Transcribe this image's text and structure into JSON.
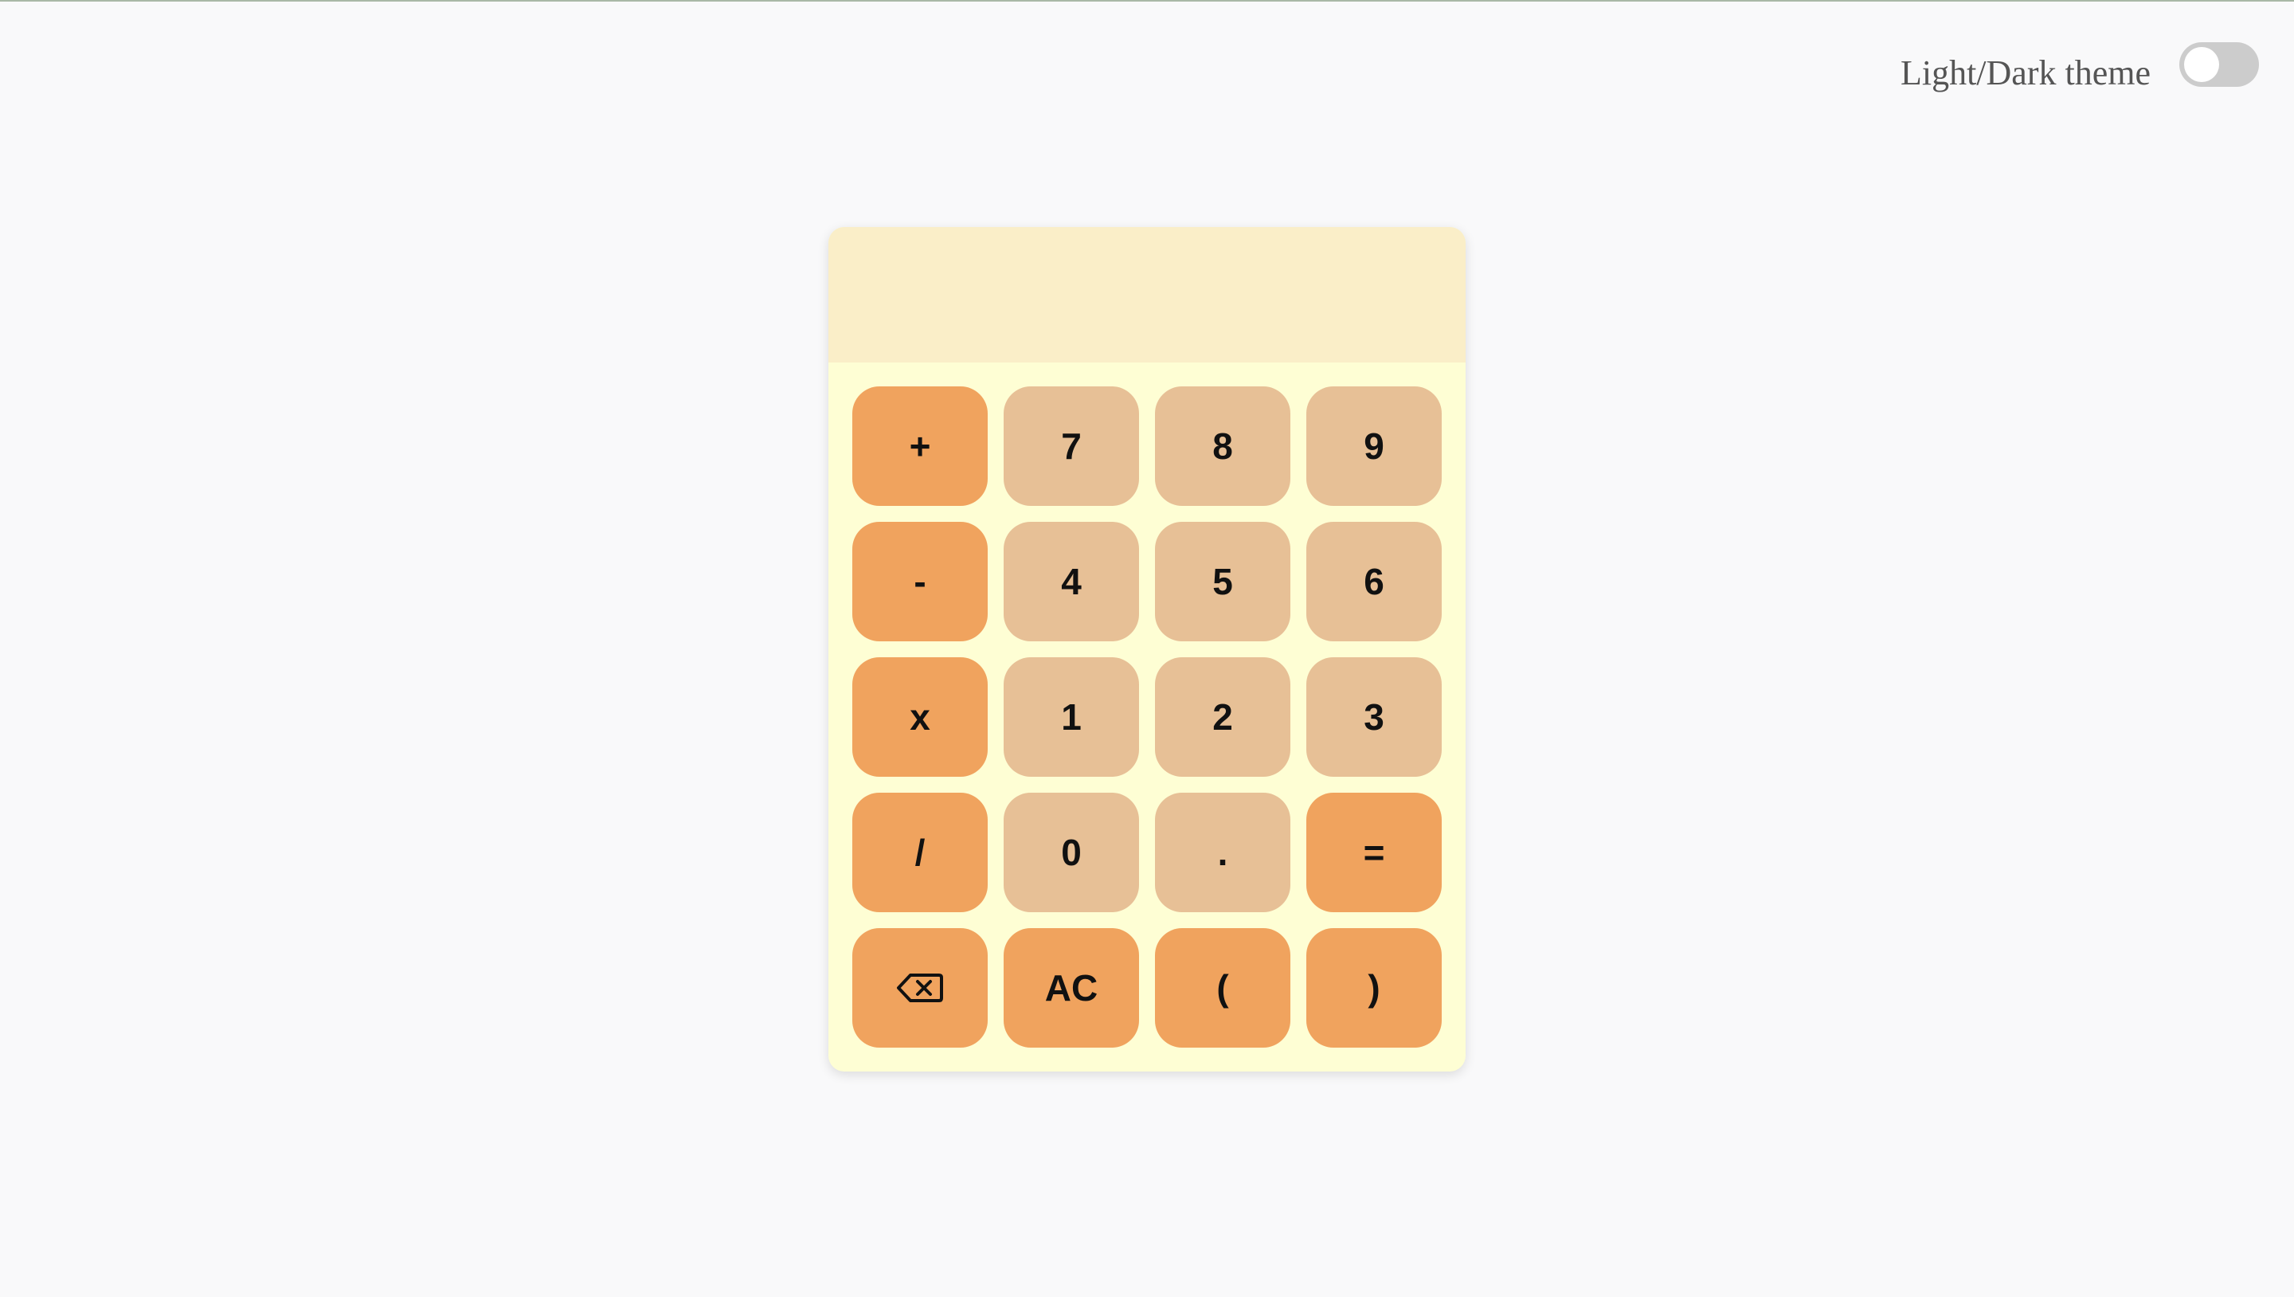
{
  "header": {
    "theme_label": "Light/Dark theme",
    "theme_toggle_on": false
  },
  "calculator": {
    "display_value": "",
    "keys": [
      {
        "label": "+",
        "kind": "op",
        "name": "plus-button"
      },
      {
        "label": "7",
        "kind": "num",
        "name": "seven-button"
      },
      {
        "label": "8",
        "kind": "num",
        "name": "eight-button"
      },
      {
        "label": "9",
        "kind": "num",
        "name": "nine-button"
      },
      {
        "label": "-",
        "kind": "op",
        "name": "minus-button"
      },
      {
        "label": "4",
        "kind": "num",
        "name": "four-button"
      },
      {
        "label": "5",
        "kind": "num",
        "name": "five-button"
      },
      {
        "label": "6",
        "kind": "num",
        "name": "six-button"
      },
      {
        "label": "x",
        "kind": "op",
        "name": "multiply-button"
      },
      {
        "label": "1",
        "kind": "num",
        "name": "one-button"
      },
      {
        "label": "2",
        "kind": "num",
        "name": "two-button"
      },
      {
        "label": "3",
        "kind": "num",
        "name": "three-button"
      },
      {
        "label": "/",
        "kind": "op",
        "name": "divide-button"
      },
      {
        "label": "0",
        "kind": "num",
        "name": "zero-button"
      },
      {
        "label": ".",
        "kind": "num",
        "name": "decimal-button"
      },
      {
        "label": "=",
        "kind": "op",
        "name": "equals-button"
      },
      {
        "label": "",
        "kind": "op",
        "name": "backspace-button",
        "icon": "backspace-icon"
      },
      {
        "label": "AC",
        "kind": "op",
        "name": "clear-button"
      },
      {
        "label": "(",
        "kind": "op",
        "name": "open-paren-button"
      },
      {
        "label": ")",
        "kind": "op",
        "name": "close-paren-button"
      }
    ]
  },
  "colors": {
    "page_background": "#f9f9fa",
    "calculator_body": "#fefed4",
    "display_background": "#faeec8",
    "operator_key": "#f0a35e",
    "number_key": "#e7c096",
    "toggle_off": "#cccccc"
  }
}
